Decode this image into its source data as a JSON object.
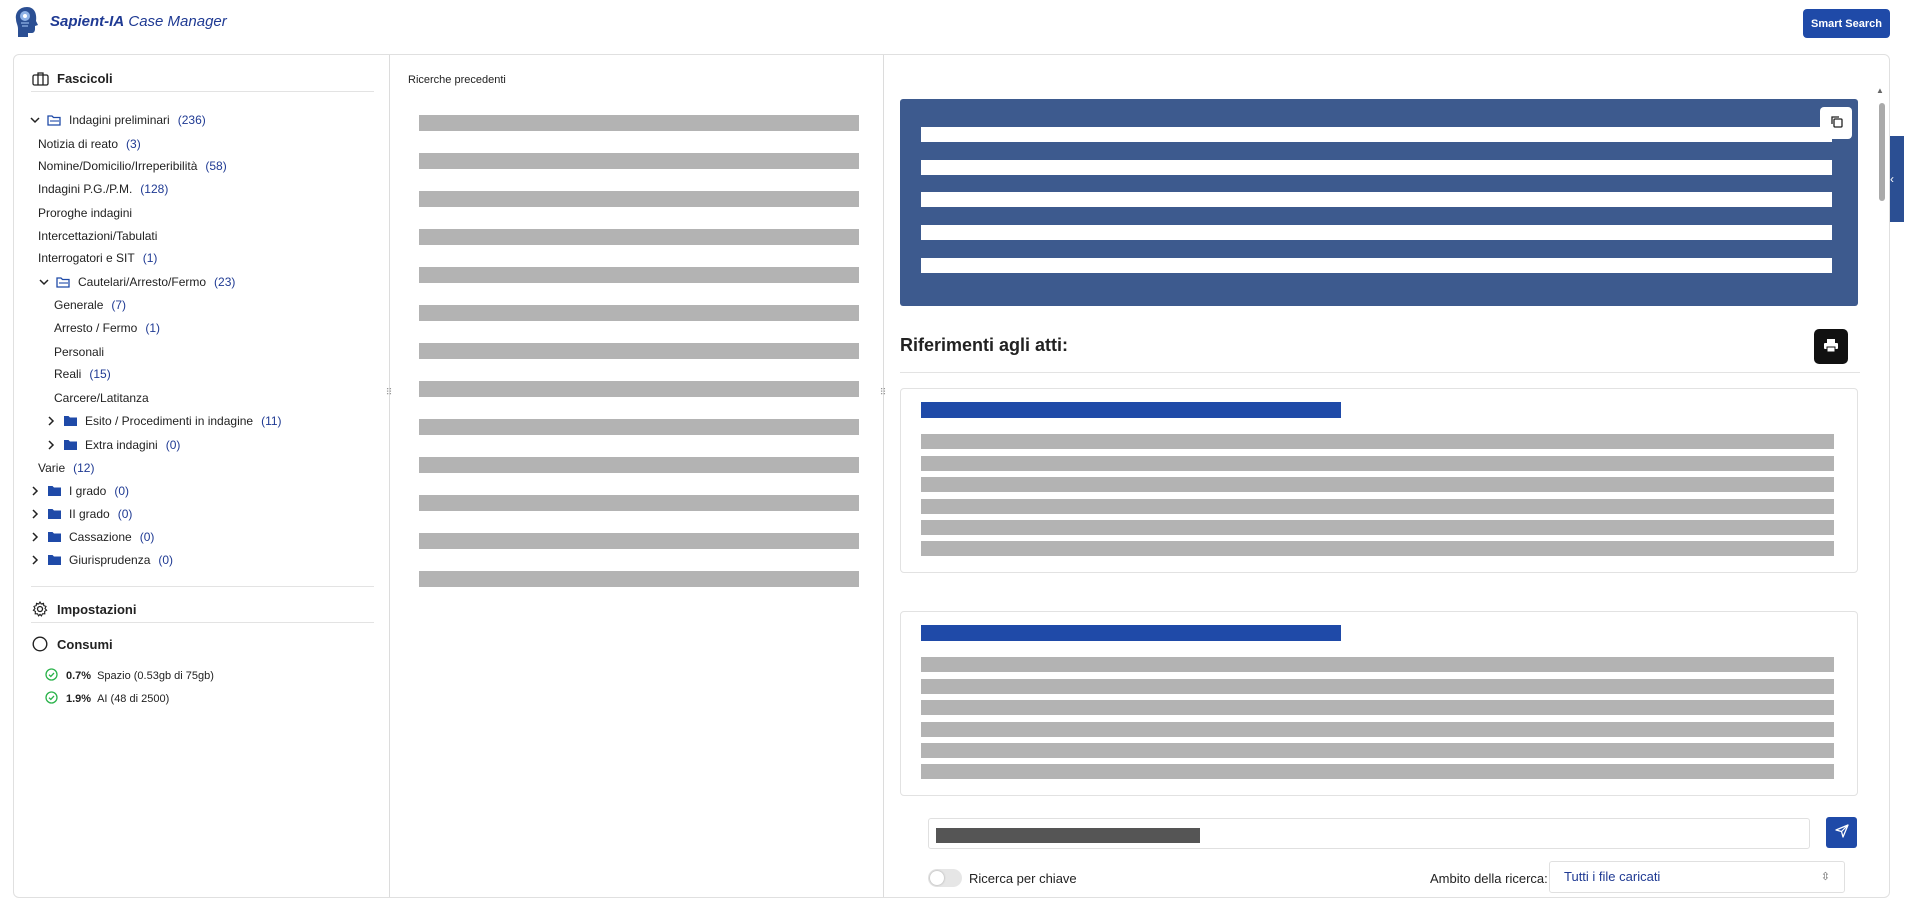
{
  "header": {
    "brand_bold": "Sapient-IA",
    "brand_rest": "Case Manager",
    "smart_search_label": "Smart Search"
  },
  "sidebar": {
    "fascicoli_title": "Fascicoli",
    "tree": [
      {
        "label": "Indagini preliminari",
        "count": "(236)"
      },
      {
        "label": "Notizia di reato",
        "count": "(3)"
      },
      {
        "label": "Nomine/Domicilio/Irreperibilità",
        "count": "(58)"
      },
      {
        "label": "Indagini P.G./P.M.",
        "count": "(128)"
      },
      {
        "label": "Proroghe indagini",
        "count": ""
      },
      {
        "label": "Intercettazioni/Tabulati",
        "count": ""
      },
      {
        "label": "Interrogatori e SIT",
        "count": "(1)"
      },
      {
        "label": "Cautelari/Arresto/Fermo",
        "count": "(23)"
      },
      {
        "label": "Generale",
        "count": "(7)"
      },
      {
        "label": "Arresto / Fermo",
        "count": "(1)"
      },
      {
        "label": "Personali",
        "count": ""
      },
      {
        "label": "Reali",
        "count": "(15)"
      },
      {
        "label": "Carcere/Latitanza",
        "count": ""
      },
      {
        "label": "Esito / Procedimenti in indagine",
        "count": "(11)"
      },
      {
        "label": "Extra indagini",
        "count": "(0)"
      },
      {
        "label": "Varie",
        "count": "(12)"
      },
      {
        "label": "I grado",
        "count": "(0)"
      },
      {
        "label": "II grado",
        "count": "(0)"
      },
      {
        "label": "Cassazione",
        "count": "(0)"
      },
      {
        "label": "Giurisprudenza",
        "count": "(0)"
      }
    ],
    "impostazioni_title": "Impostazioni",
    "consumi_title": "Consumi",
    "usage": [
      {
        "pct": "0.7%",
        "label": "Spazio (0.53gb di 75gb)"
      },
      {
        "pct": "1.9%",
        "label": "AI (48 di 2500)"
      }
    ]
  },
  "middle": {
    "title": "Ricerche precedenti"
  },
  "right": {
    "references_title": "Riferimenti agli atti:",
    "toggle_label": "Ricerca per chiave",
    "scope_label": "Ambito della ricerca:",
    "scope_value": "Tutti i file caricati"
  },
  "colors": {
    "primary": "#1f4aa8",
    "answer_bg": "#3d5a8e",
    "skeleton": "#b3b3b3",
    "usage_ok": "#2bb34b"
  },
  "icons": {
    "fascicoli": "briefcase-icon",
    "impostazioni": "gear-icon",
    "consumi": "circle-icon",
    "usage": "check-circle-icon",
    "folder_open": "folder-open-icon",
    "folder": "folder-icon",
    "copy": "copy-icon",
    "print": "printer-icon",
    "send": "send-icon"
  }
}
